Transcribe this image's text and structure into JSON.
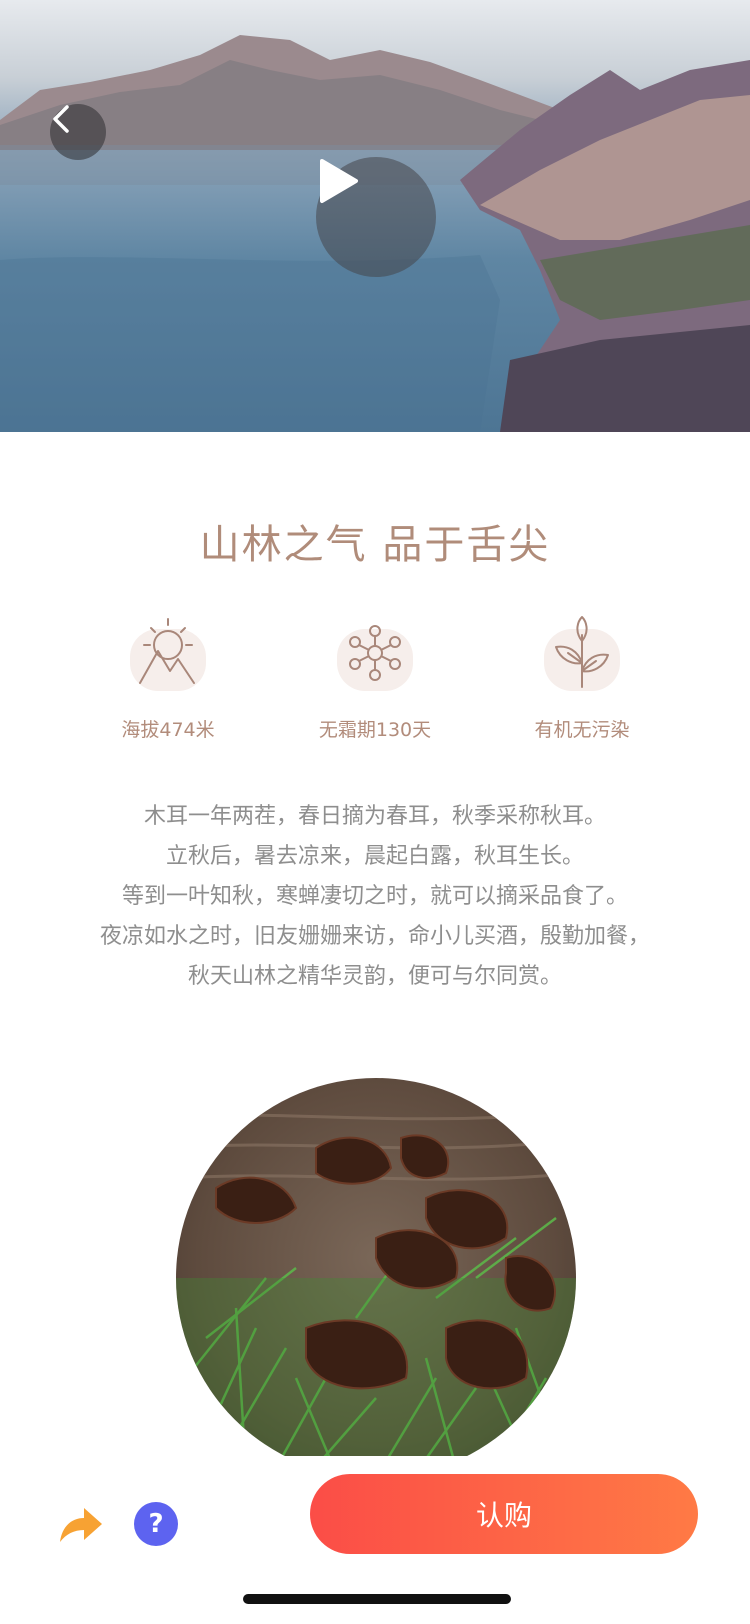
{
  "hero": {
    "back_icon": "chevron-left-icon",
    "play_icon": "play-icon"
  },
  "title": "山林之气 品于舌尖",
  "features": [
    {
      "icon": "sun-mountain-icon",
      "label": "海拔474米"
    },
    {
      "icon": "snowflake-icon",
      "label": "无霜期130天"
    },
    {
      "icon": "leaf-plant-icon",
      "label": "有机无污染"
    }
  ],
  "description": [
    "木耳一年两茬，春日摘为春耳，秋季采称秋耳。",
    "立秋后，暑去凉来，晨起白露，秋耳生长。",
    "等到一叶知秋，寒蝉凄切之时，就可以摘采品食了。",
    "夜凉如水之时，旧友姗姗来访，命小儿买酒，殷勤加餐，",
    "秋天山林之精华灵韵，便可与尔同赏。"
  ],
  "bottom_bar": {
    "share_icon": "share-arrow-icon",
    "help_label": "?",
    "buy_label": "认购"
  },
  "colors": {
    "accent_brown": "#b08c7a",
    "buy_gradient_start": "#fb4d47",
    "buy_gradient_end": "#ff7a45",
    "help_blue": "#5d63f0",
    "share_orange": "#f7a233"
  }
}
